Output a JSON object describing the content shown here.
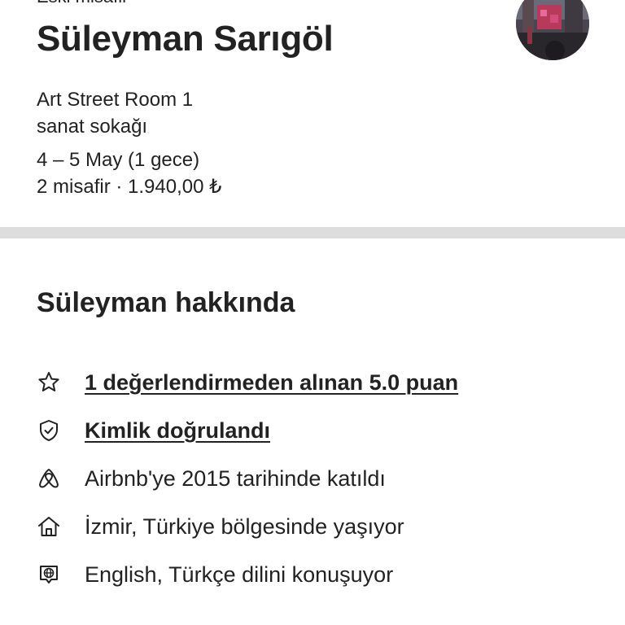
{
  "header": {
    "top_label": "Eski misafir",
    "host_name": "Süleyman Sarıgöl",
    "avatar_icon": "host-photo"
  },
  "trip": {
    "listing_name": "Art Street Room 1",
    "location": "sanat sokağı",
    "dates": "4 – 5 May (1 gece)",
    "guests_price": "2 misafir · 1.940,00 ₺"
  },
  "about": {
    "title": "Süleyman hakkında",
    "facts": [
      {
        "icon": "star-icon",
        "label": "1 değerlendirmeden alınan 5.0 puan",
        "link": true
      },
      {
        "icon": "shield-check-icon",
        "label": "Kimlik doğrulandı",
        "link": true
      },
      {
        "icon": "airbnb-logo-icon",
        "label": "Airbnb'ye 2015 tarihinde katıldı",
        "link": false
      },
      {
        "icon": "home-icon",
        "label": "İzmir, Türkiye bölgesinde yaşıyor",
        "link": false
      },
      {
        "icon": "language-icon",
        "label": "English,  Türkçe dilini konuşuyor",
        "link": false
      }
    ]
  },
  "colors": {
    "text": "#222222",
    "divider": "#dddddd",
    "background": "#ffffff"
  }
}
